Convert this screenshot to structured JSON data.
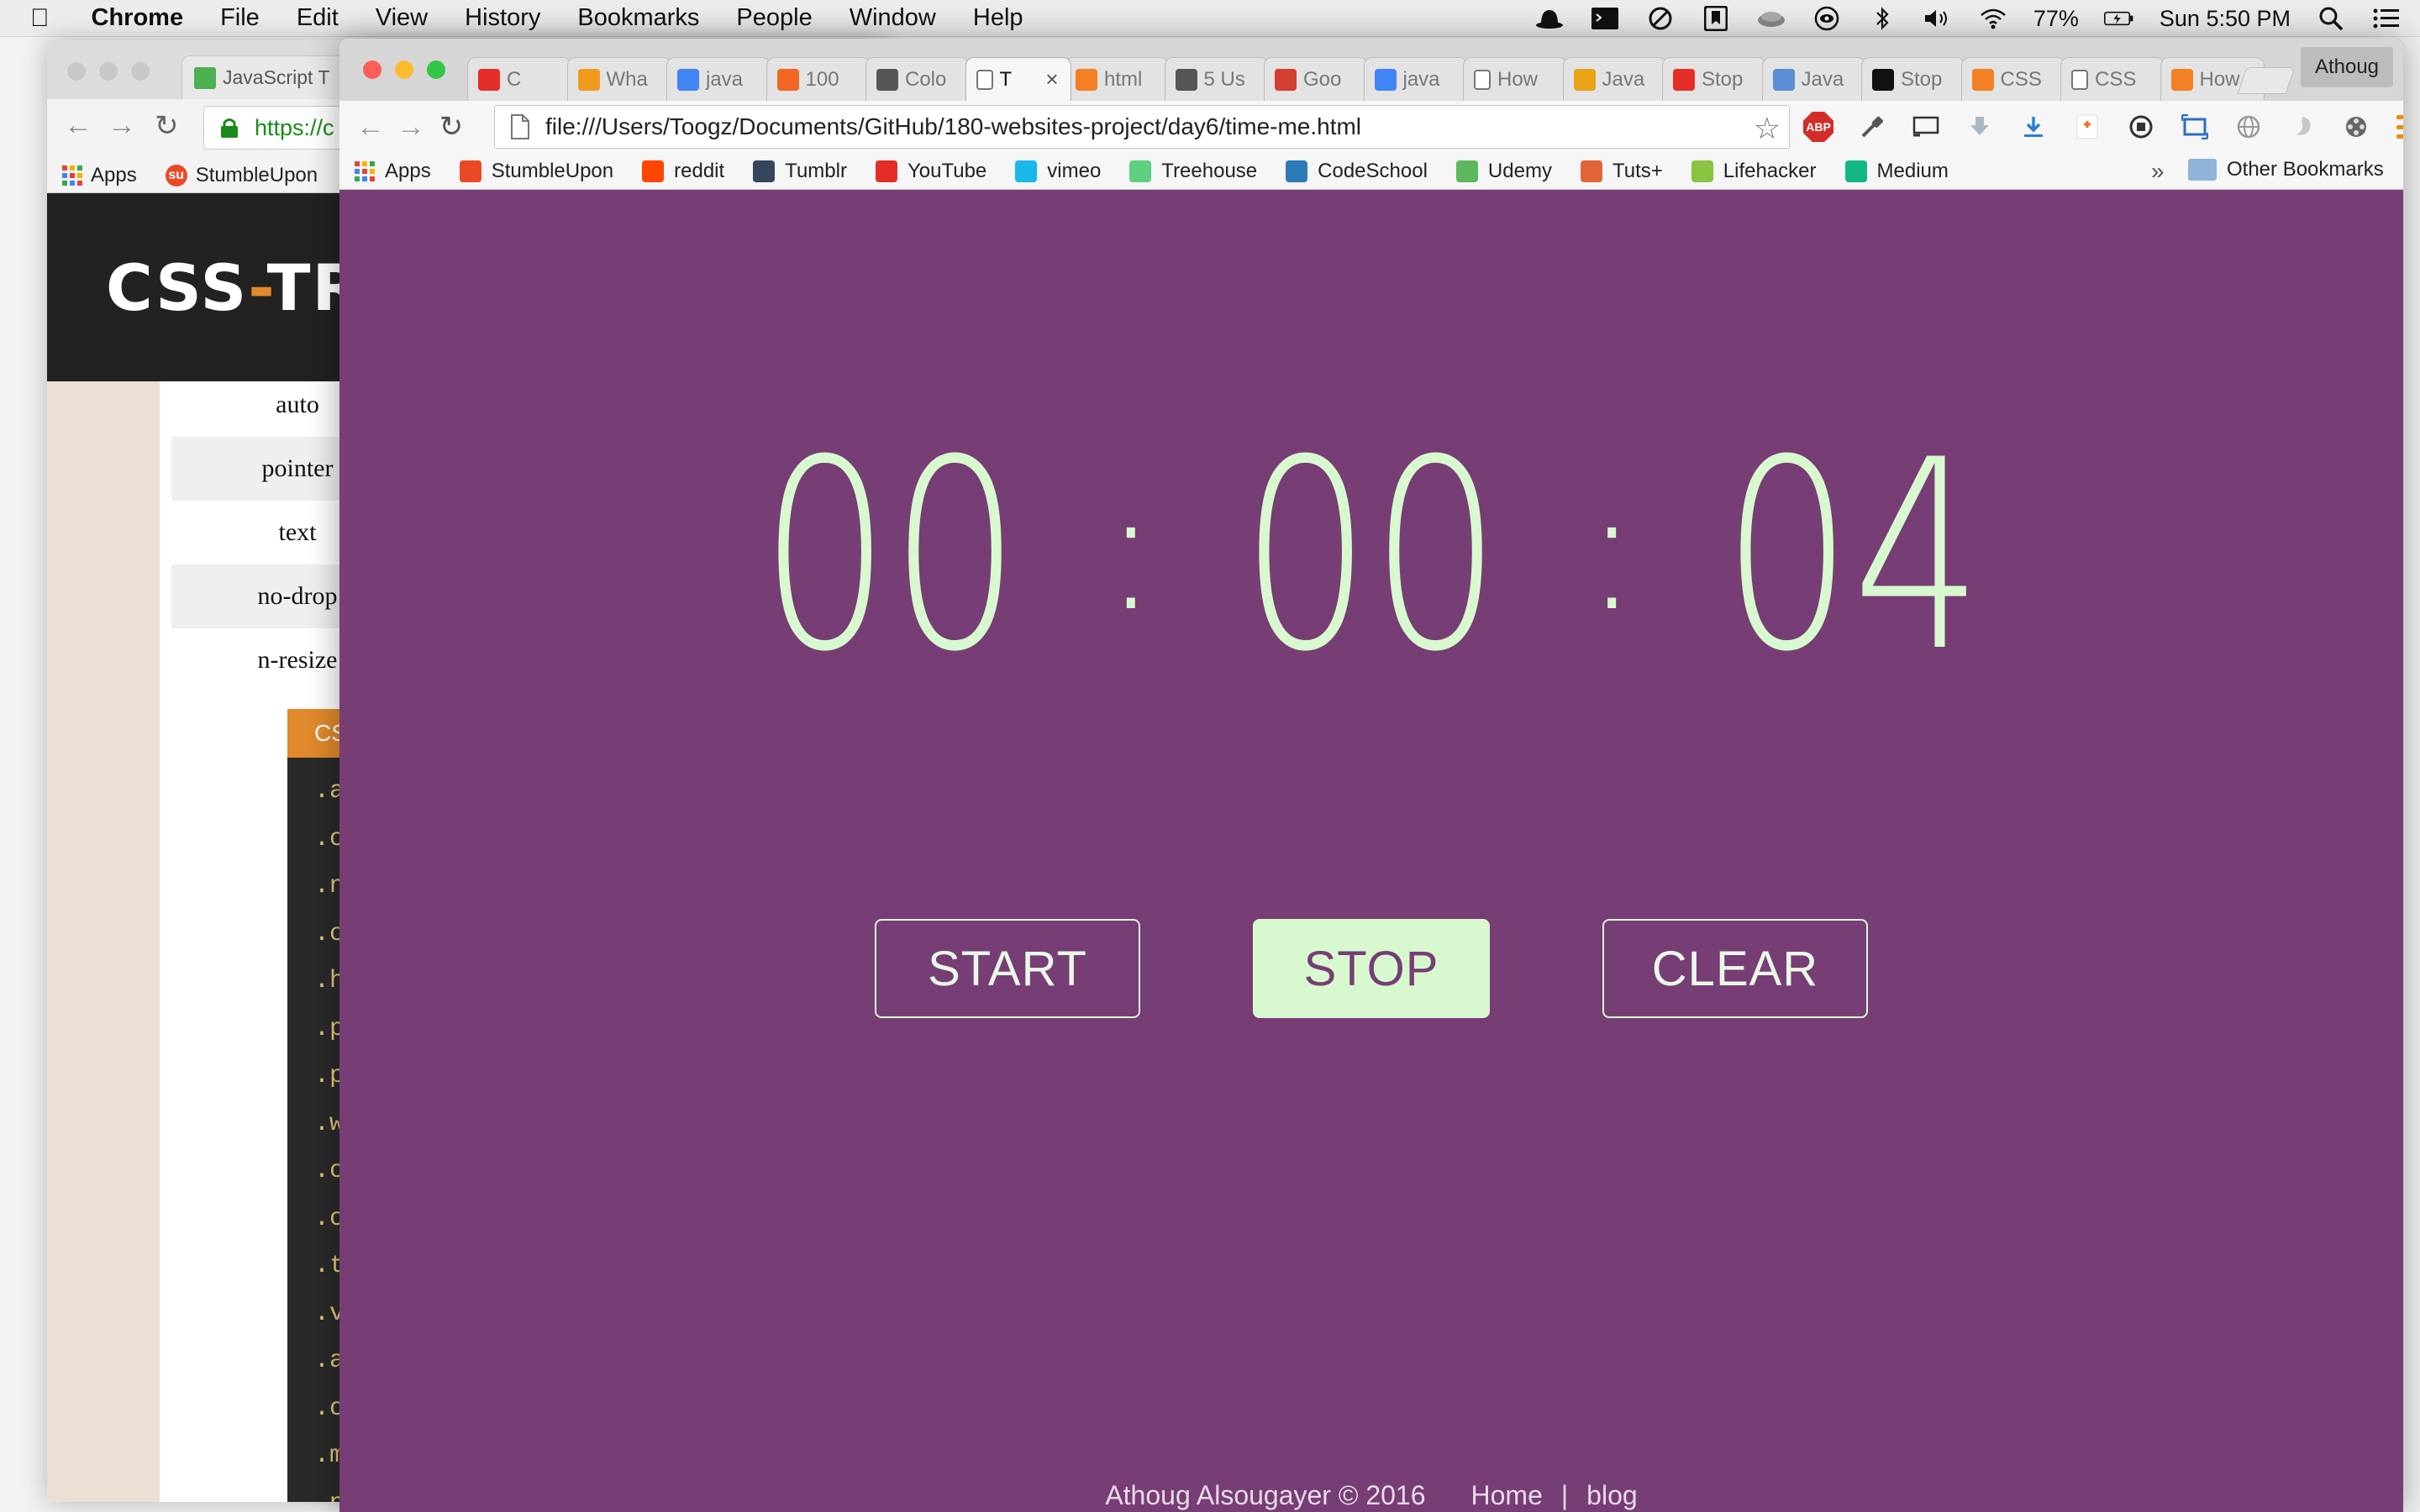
{
  "menubar": {
    "app": "Chrome",
    "items": [
      "File",
      "Edit",
      "View",
      "History",
      "Bookmarks",
      "People",
      "Window",
      "Help"
    ],
    "battery": "77%",
    "clock": "Sun 5:50 PM"
  },
  "back_window": {
    "tab_title": "JavaScript T",
    "url": "https://c",
    "bookmarks": [
      "Apps",
      "StumbleUpon"
    ],
    "logo_left": "CSS",
    "logo_right": "TR",
    "cursor_values": [
      "auto",
      "pointer",
      "text",
      "no-drop",
      "n-resize"
    ],
    "code_header": "CS",
    "code_lines": [
      ".a",
      ".c",
      ".n",
      ".c",
      ".h",
      ".p",
      ".p",
      ".w",
      ".c",
      ".c",
      ".t",
      ".v",
      ".a",
      ".c",
      ".m",
      ".n"
    ]
  },
  "tabs": [
    {
      "label": "C",
      "icon": "youtube-icon",
      "color": "#e52d27"
    },
    {
      "label": "Wha",
      "icon": "asterisk-icon",
      "color": "#f09a1e"
    },
    {
      "label": "java",
      "icon": "google-icon",
      "color": "#4285f4"
    },
    {
      "label": "100",
      "icon": "cs-icon",
      "color": "#f26522"
    },
    {
      "label": "Colo",
      "icon": "dropper-icon",
      "color": "#555555"
    },
    {
      "label": "T",
      "icon": "page-icon",
      "color": "#ffffff",
      "active": true
    },
    {
      "label": "html",
      "icon": "stackoverflow-icon",
      "color": "#f48024"
    },
    {
      "label": "5 Us",
      "icon": "wikipedia-icon",
      "color": "#555555"
    },
    {
      "label": "Goo",
      "icon": "fontello-icon",
      "color": "#d23f31"
    },
    {
      "label": "java",
      "icon": "google-icon",
      "color": "#4285f4"
    },
    {
      "label": "How",
      "icon": "page-icon",
      "color": "#ffffff"
    },
    {
      "label": "Java",
      "icon": "lion-icon",
      "color": "#e8a317"
    },
    {
      "label": "Stop",
      "icon": "youtube-icon",
      "color": "#e52d27"
    },
    {
      "label": "Java",
      "icon": "cloud-icon",
      "color": "#5a8ed6"
    },
    {
      "label": "Stop",
      "icon": "codepen-icon",
      "color": "#111111"
    },
    {
      "label": "CSS",
      "icon": "stackoverflow-icon",
      "color": "#f48024"
    },
    {
      "label": "CSS",
      "icon": "page-icon",
      "color": "#ffffff"
    },
    {
      "label": "How",
      "icon": "stackoverflow-icon",
      "color": "#f48024"
    }
  ],
  "profile": "Athoug",
  "url": "file:///Users/Toogz/Documents/GitHub/180-websites-project/day6/time-me.html",
  "bookmarks": [
    {
      "label": "Apps",
      "icon": "apps-icon",
      "color": "#4285f4"
    },
    {
      "label": "StumbleUpon",
      "icon": "stumbleupon-icon",
      "color": "#eb4924"
    },
    {
      "label": "reddit",
      "icon": "reddit-icon",
      "color": "#ff4500"
    },
    {
      "label": "Tumblr",
      "icon": "tumblr-icon",
      "color": "#35465c"
    },
    {
      "label": "YouTube",
      "icon": "youtube-icon",
      "color": "#e52d27"
    },
    {
      "label": "vimeo",
      "icon": "vimeo-icon",
      "color": "#1ab7ea"
    },
    {
      "label": "Treehouse",
      "icon": "treehouse-icon",
      "color": "#5fcf80"
    },
    {
      "label": "CodeSchool",
      "icon": "codeschool-icon",
      "color": "#2b7bb9"
    },
    {
      "label": "Udemy",
      "icon": "udemy-icon",
      "color": "#5cb85c"
    },
    {
      "label": "Tuts+",
      "icon": "tuts-icon",
      "color": "#e06638"
    },
    {
      "label": "Lifehacker",
      "icon": "lifehacker-icon",
      "color": "#89c341"
    },
    {
      "label": "Medium",
      "icon": "medium-icon",
      "color": "#12b886"
    }
  ],
  "bookmarks_overflow": "»",
  "other_bookmarks": "Other Bookmarks",
  "timer": {
    "hours": "00",
    "minutes": "00",
    "seconds": "04",
    "separator": ":"
  },
  "buttons": {
    "start": "START",
    "stop": "STOP",
    "clear": "CLEAR"
  },
  "footer": {
    "author": "Athoug Alsougayer © 2016",
    "home": "Home",
    "separator": "|",
    "blog": "blog"
  },
  "colors": {
    "page_background": "#763e74",
    "accent": "#d8f8cf"
  }
}
